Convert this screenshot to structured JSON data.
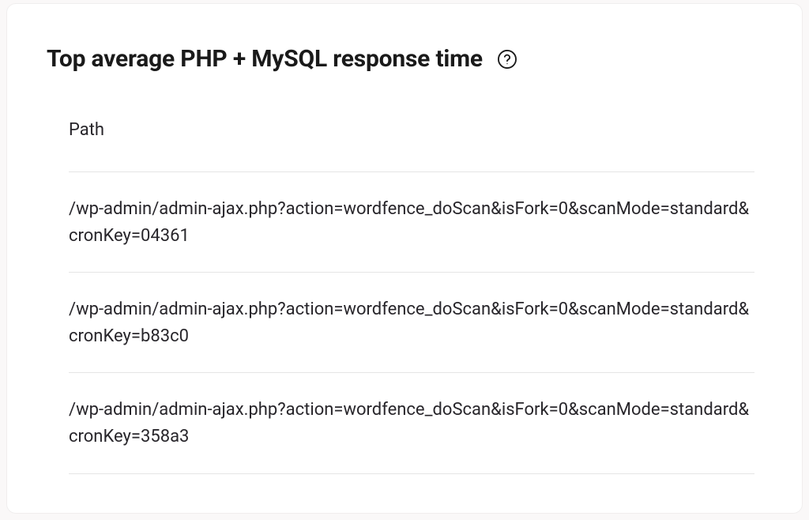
{
  "card": {
    "title": "Top average PHP + MySQL response time",
    "help_tooltip": "Help"
  },
  "table": {
    "column_header": "Path",
    "rows": [
      {
        "path": "/wp-admin/admin-ajax.php?action=wordfence_doScan&isFork=0&scanMode=standard&cronKey=04361"
      },
      {
        "path": "/wp-admin/admin-ajax.php?action=wordfence_doScan&isFork=0&scanMode=standard&cronKey=b83c0"
      },
      {
        "path": "/wp-admin/admin-ajax.php?action=wordfence_doScan&isFork=0&scanMode=standard&cronKey=358a3"
      }
    ]
  }
}
